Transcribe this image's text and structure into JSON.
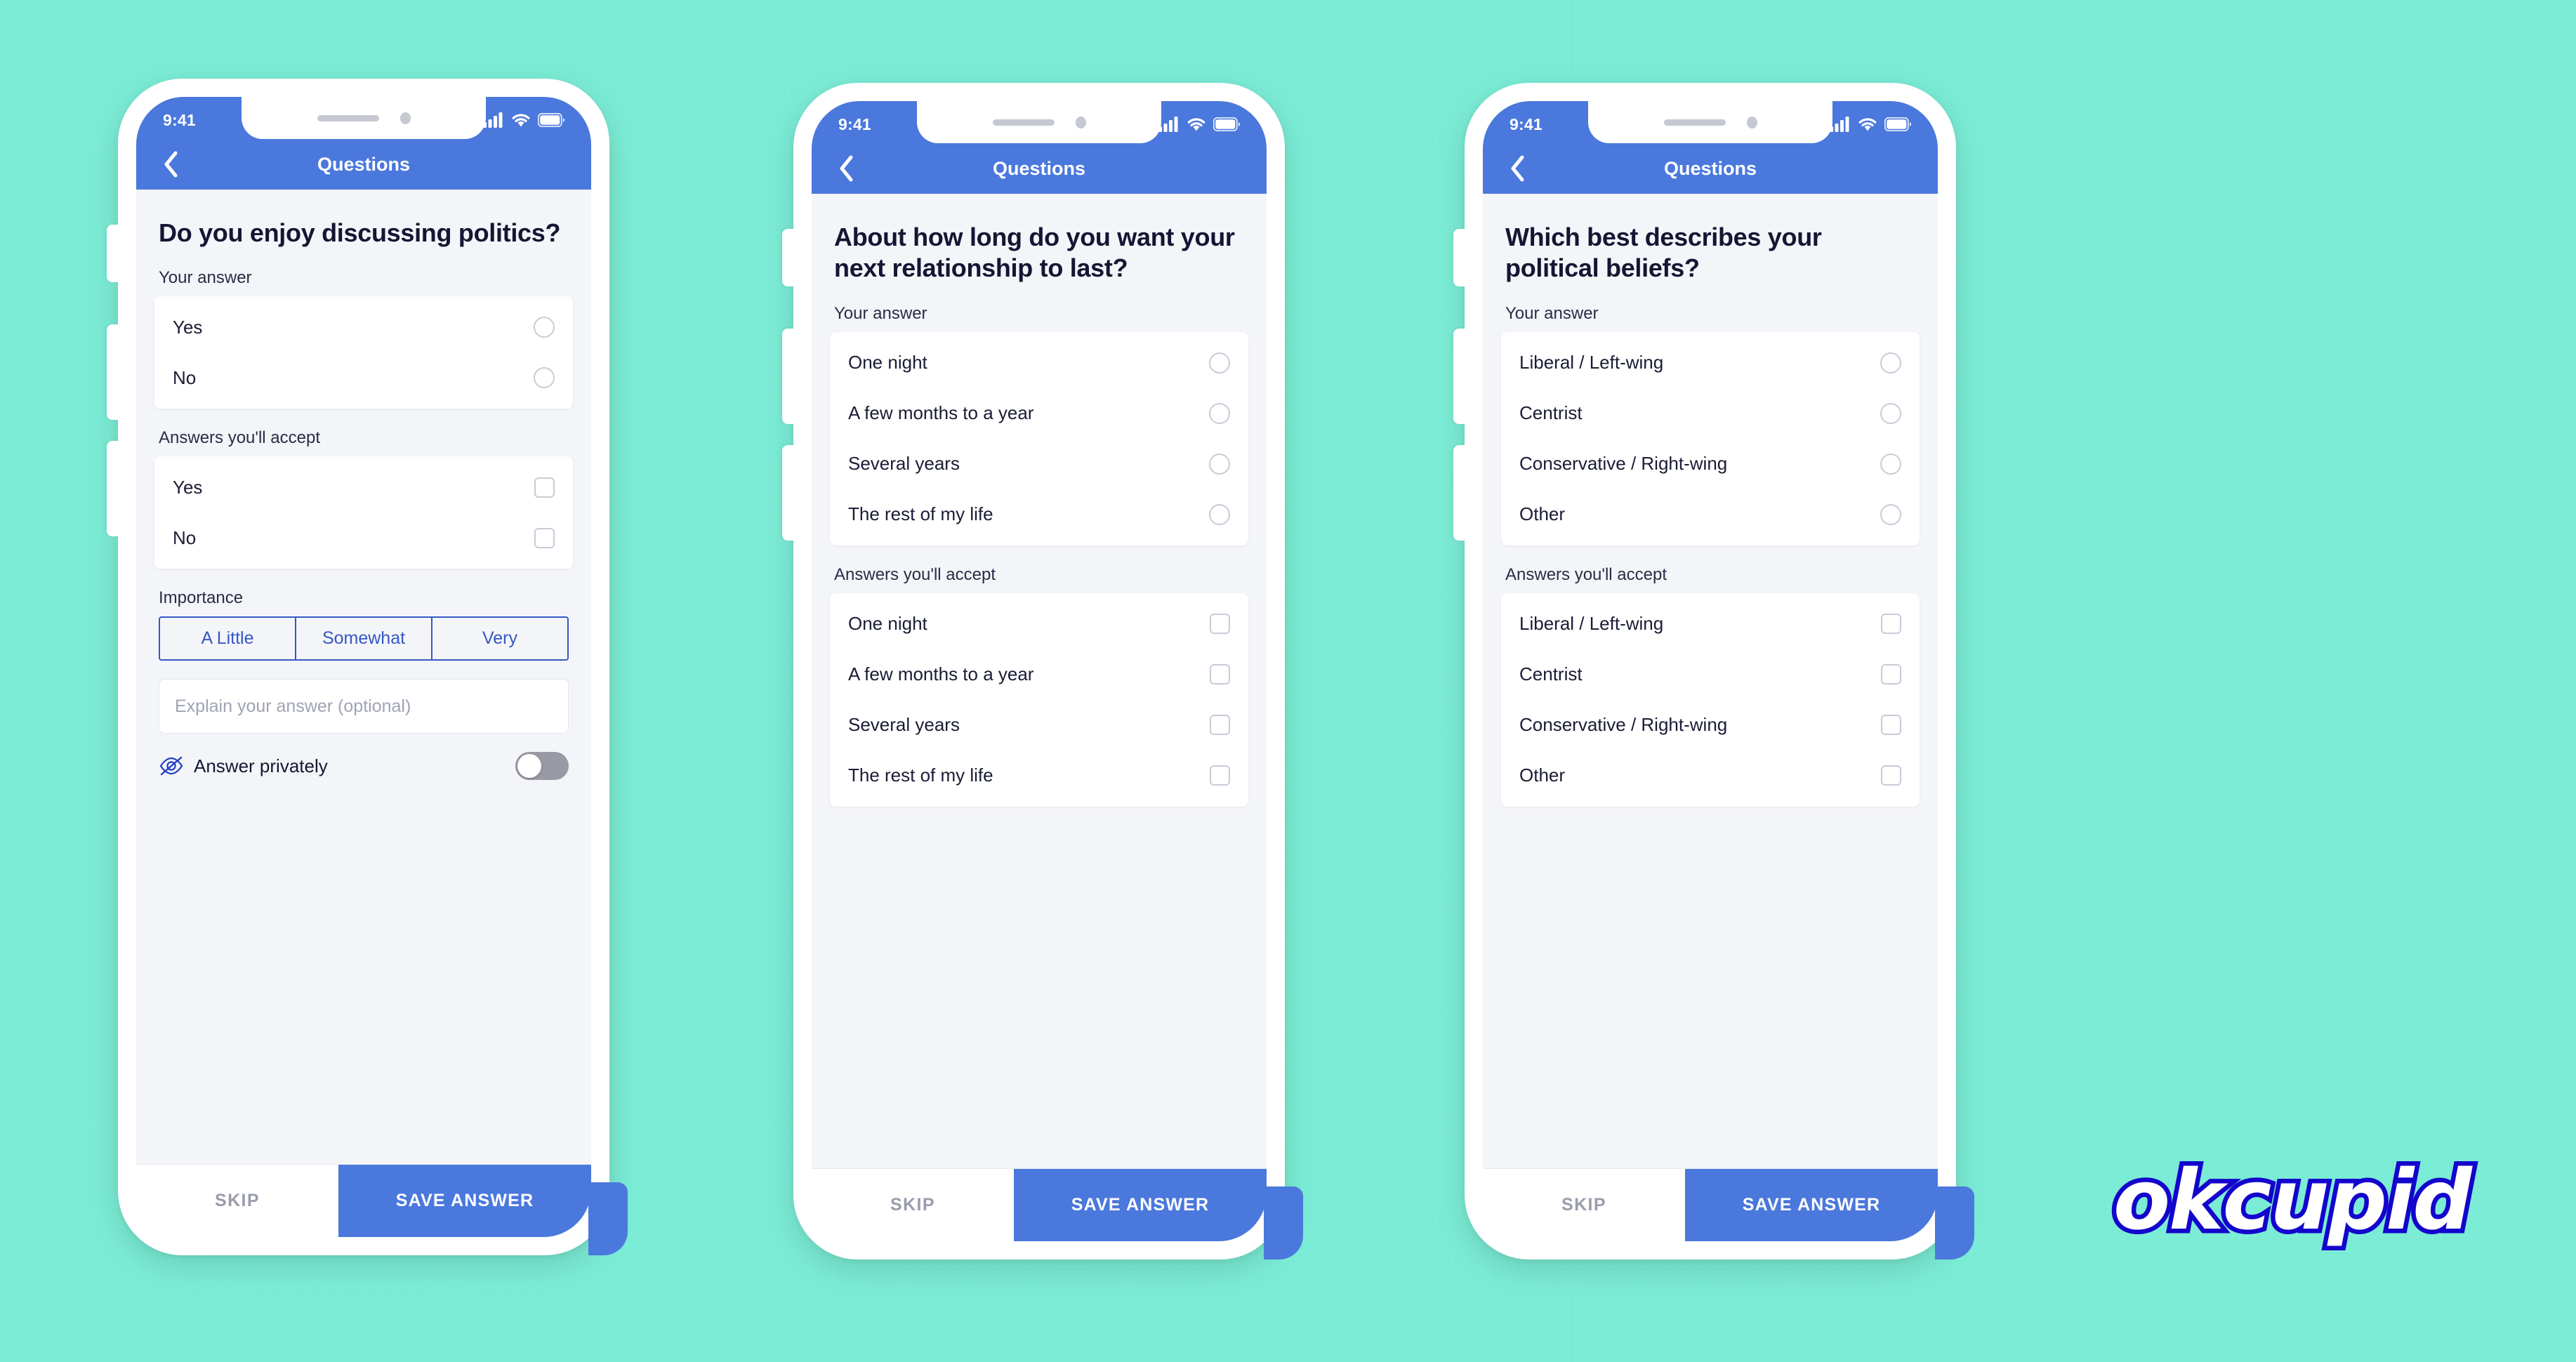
{
  "background_color": "#7aecd5",
  "brand": {
    "logo_text": "okcupid",
    "logo_fill": "#ffffff",
    "logo_outline": "#1405cc"
  },
  "theme": {
    "header_blue": "#4a78dc",
    "accent_blue": "#3558c4",
    "screen_bg": "#f4f5f9",
    "card_bg": "#ffffff",
    "text_dark": "#141633",
    "muted": "#9a9cab"
  },
  "status_bar": {
    "time": "9:41",
    "cellular_icon": "cellular-signal-icon",
    "wifi_icon": "wifi-icon",
    "battery_icon": "battery-icon"
  },
  "nav": {
    "title": "Questions",
    "back_icon": "back-chevron-icon"
  },
  "actions": {
    "skip_label": "SKIP",
    "save_label": "SAVE ANSWER"
  },
  "labels": {
    "your_answer": "Your answer",
    "answers_youll_accept": "Answers you'll accept",
    "importance": "Importance",
    "answer_privately": "Answer privately",
    "explain_placeholder": "Explain your answer (optional)",
    "eye_off_icon": "eye-off-icon",
    "toggle_state": "off"
  },
  "importance_options": [
    "A Little",
    "Somewhat",
    "Very"
  ],
  "screens": [
    {
      "id": "screen-1",
      "question": "Do you enjoy discussing politics?",
      "your_answer_options": [
        "Yes",
        "No"
      ],
      "accept_options": [
        "Yes",
        "No"
      ],
      "has_importance": true,
      "has_explain": true,
      "has_privacy_toggle": true
    },
    {
      "id": "screen-2",
      "question": "About how long do you want your next relationship to last?",
      "your_answer_options": [
        "One night",
        "A few months to a year",
        "Several years",
        "The rest of my life"
      ],
      "accept_options": [
        "One night",
        "A few months to a year",
        "Several years",
        "The rest of my life"
      ],
      "has_importance": false,
      "has_explain": false,
      "has_privacy_toggle": false
    },
    {
      "id": "screen-3",
      "question": "Which best describes your political beliefs?",
      "your_answer_options": [
        "Liberal / Left-wing",
        "Centrist",
        "Conservative / Right-wing",
        "Other"
      ],
      "accept_options": [
        "Liberal / Left-wing",
        "Centrist",
        "Conservative / Right-wing",
        "Other"
      ],
      "has_importance": false,
      "has_explain": false,
      "has_privacy_toggle": false
    }
  ]
}
